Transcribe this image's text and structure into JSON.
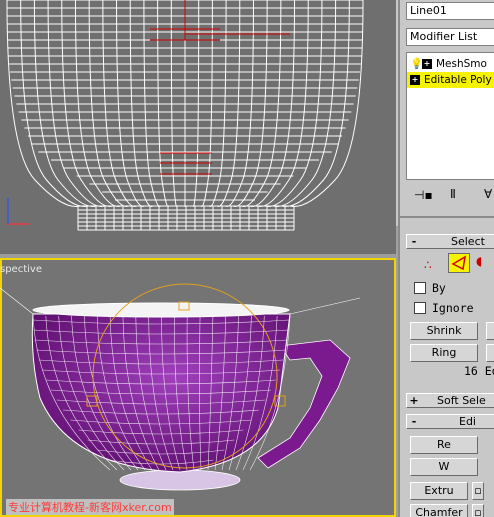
{
  "viewports": {
    "front": {
      "label": ""
    },
    "perspective": {
      "label": "spective"
    }
  },
  "watermark": "专业计算机教程-新客网xker.com",
  "panel": {
    "object_name": "Line01",
    "modifier_list": "Modifier List",
    "stack": [
      {
        "label": "MeshSmo",
        "selected": false,
        "icon": "bulb-icon"
      },
      {
        "label": "Editable Poly",
        "selected": true,
        "icon": ""
      }
    ],
    "selection_rollout": {
      "sign": "-",
      "title": "Select"
    },
    "by_label": "By",
    "ignore_label": "Ignore",
    "shrink_label": "Shrink",
    "ring_label": "Ring",
    "edges_count": "16 Edg",
    "soft_selection_rollout": {
      "sign": "+",
      "title": "Soft Sele"
    },
    "edit_rollout": {
      "sign": "-",
      "title": "Edi"
    },
    "remove_label": "Re",
    "weld_label": "W",
    "extrude_label": "Extru",
    "chamfer_label": "Chamfer"
  },
  "colors": {
    "selection_yellow": "#f6f300",
    "mug_purple": "#7a1a8e",
    "wire_white": "#ffffff",
    "gizmo_orange": "#e0a020"
  }
}
